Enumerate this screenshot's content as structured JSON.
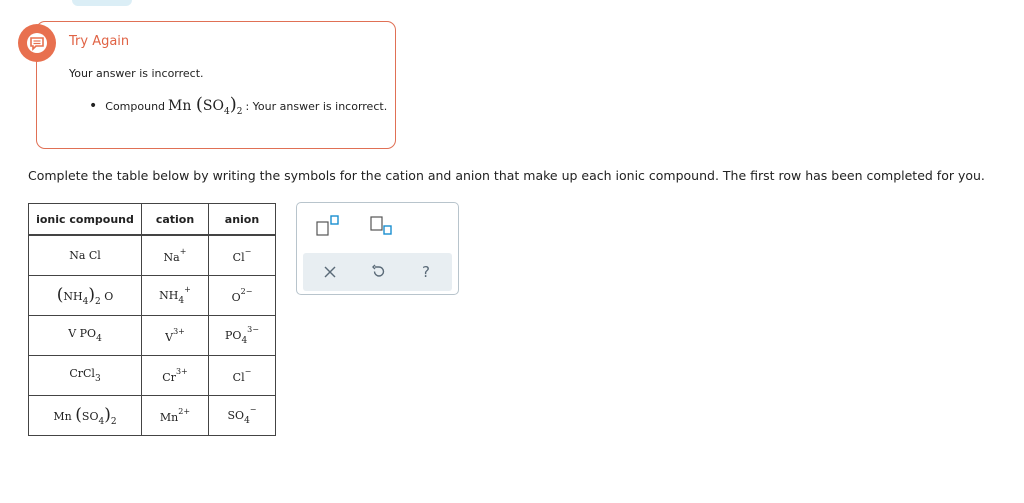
{
  "feedback": {
    "title": "Try Again",
    "message": "Your answer is incorrect.",
    "bullet_prefix": "Compound",
    "bullet_formula_main": "Mn",
    "bullet_formula_group": "SO",
    "bullet_formula_group_sub": "4",
    "bullet_formula_sub": "2",
    "bullet_suffix": ": Your answer is incorrect.",
    "accent_color": "#e8704f",
    "icon": "chat-bubble-icon"
  },
  "instructions": "Complete the table below by writing the symbols for the cation and anion that make up each ionic compound. The first row has been completed for you.",
  "table": {
    "headers": [
      "ionic compound",
      "cation",
      "anion"
    ],
    "rows": [
      {
        "compound": {
          "base": "Na Cl"
        },
        "cation": {
          "base": "Na",
          "sub": "",
          "sup": "+"
        },
        "anion": {
          "base": "Cl",
          "sub": "",
          "sup": "−"
        }
      },
      {
        "compound": {
          "group": "NH",
          "group_sub": "4",
          "paren_sub": "2",
          "tail": "O"
        },
        "cation": {
          "base": "NH",
          "sub": "4",
          "sup": "+"
        },
        "anion": {
          "base": "O",
          "sub": "",
          "sup": "2−"
        }
      },
      {
        "compound": {
          "base": "V PO",
          "sub": "4"
        },
        "cation": {
          "base": "V",
          "sub": "",
          "sup": "3+"
        },
        "anion": {
          "base": "PO",
          "sub": "4",
          "sup": "3−"
        }
      },
      {
        "compound": {
          "base": "CrCl",
          "sub": "3"
        },
        "cation": {
          "base": "Cr",
          "sub": "",
          "sup": "3+"
        },
        "anion": {
          "base": "Cl",
          "sub": "",
          "sup": "−"
        }
      },
      {
        "compound": {
          "lead": "Mn",
          "group": "SO",
          "group_sub": "4",
          "paren_sub": "2"
        },
        "cation": {
          "base": "Mn",
          "sub": "",
          "sup": "2+"
        },
        "anion": {
          "base": "SO",
          "sub": "4",
          "sup": "−"
        }
      }
    ]
  },
  "toolbar": {
    "tools": [
      "superscript-template-icon",
      "subscript-template-icon"
    ],
    "actions": [
      "clear-icon",
      "undo-icon",
      "help-icon"
    ],
    "help_label": "?"
  }
}
